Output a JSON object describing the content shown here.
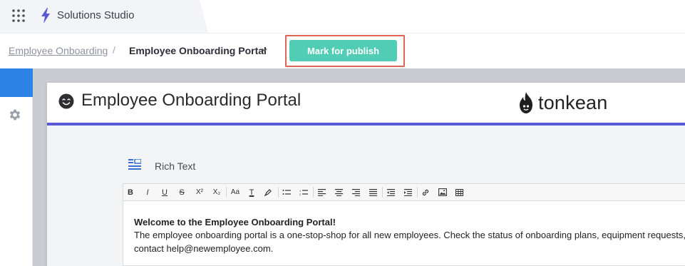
{
  "app": {
    "title": "Solutions Studio",
    "apps_icon": "grid-dots-icon",
    "brand_icon": "bolt-icon"
  },
  "breadcrumb": {
    "parent": "Employee Onboarding",
    "separator": "/",
    "current": "Employee Onboarding Portal",
    "current_icon": "chevron-down-icon"
  },
  "actions": {
    "publish_label": "Mark for publish",
    "publish_color": "#52cdb5",
    "highlight_color": "#e06457"
  },
  "sidebar": {
    "items": [
      {
        "icon": "active-tab",
        "active": true
      },
      {
        "icon": "gear-icon",
        "active": false
      }
    ]
  },
  "portal": {
    "title": "Employee Onboarding Portal",
    "title_icon": "smile-icon",
    "brand": "tonkean",
    "brand_icon": "flame-icon",
    "accent_color": "#5b5ad6"
  },
  "rich_text": {
    "label": "Rich Text",
    "toolbar": [
      {
        "name": "bold",
        "glyph": "B"
      },
      {
        "name": "italic",
        "glyph": "I"
      },
      {
        "name": "underline",
        "glyph": "U"
      },
      {
        "name": "strikethrough",
        "glyph": "S"
      },
      {
        "name": "superscript",
        "glyph": "X²"
      },
      {
        "name": "subscript",
        "glyph": "X₂"
      },
      {
        "name": "font-size",
        "glyph": "Aa"
      },
      {
        "name": "text-color",
        "glyph": "T"
      },
      {
        "name": "highlight",
        "glyph": ""
      },
      {
        "name": "bullet-list",
        "glyph": ""
      },
      {
        "name": "numbered-list",
        "glyph": ""
      },
      {
        "name": "align-left",
        "glyph": ""
      },
      {
        "name": "align-center",
        "glyph": ""
      },
      {
        "name": "align-right",
        "glyph": ""
      },
      {
        "name": "align-justify",
        "glyph": ""
      },
      {
        "name": "outdent",
        "glyph": ""
      },
      {
        "name": "indent",
        "glyph": ""
      },
      {
        "name": "link",
        "glyph": ""
      },
      {
        "name": "image",
        "glyph": ""
      },
      {
        "name": "table",
        "glyph": ""
      }
    ],
    "content": {
      "heading": "Welcome to the Employee Onboarding Portal!",
      "line1": "The employee onboarding portal is a one-stop-shop for all new employees. Check the status of onboarding plans, equipment requests,",
      "line2": "contact help@newemployee.com."
    }
  }
}
